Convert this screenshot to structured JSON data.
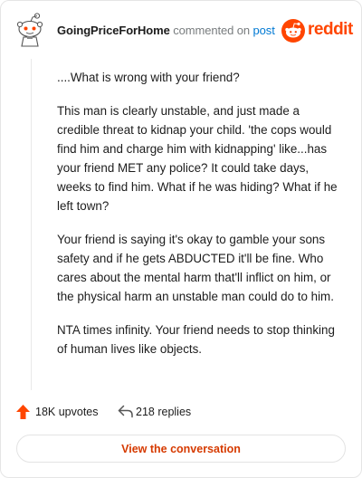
{
  "header": {
    "username": "GoingPriceForHome",
    "commented_text": "commented on",
    "post_link": "post",
    "brand_wordmark": "reddit",
    "brand_color": "#ff4500",
    "avatar_icon": "snoo-avatar-icon"
  },
  "comment": {
    "paragraphs": [
      "....What is wrong with your friend?",
      "This man is clearly unstable, and just made a credible threat to kidnap your child. 'the cops would find him and charge him with kidnapping' like...has your friend MET any police? It could take days, weeks to find him. What if he was hiding? What if he left town?",
      "Your friend is saying it's okay to gamble your sons safety and if he gets ABDUCTED it'll be fine. Who cares about the mental harm that'll inflict on him, or the physical harm an unstable man could do to him.",
      "NTA times infinity. Your friend needs to stop thinking of human lives like objects."
    ]
  },
  "actions": {
    "upvotes": "18K upvotes",
    "replies": "218 replies",
    "upvote_icon": "upvote-arrow-icon",
    "reply_icon": "reply-arrow-icon"
  },
  "cta": {
    "label": "View the conversation"
  },
  "colors": {
    "accent": "#ff4500",
    "link": "#0079d3",
    "muted": "#787c7e",
    "cta_text": "#d63a00"
  }
}
